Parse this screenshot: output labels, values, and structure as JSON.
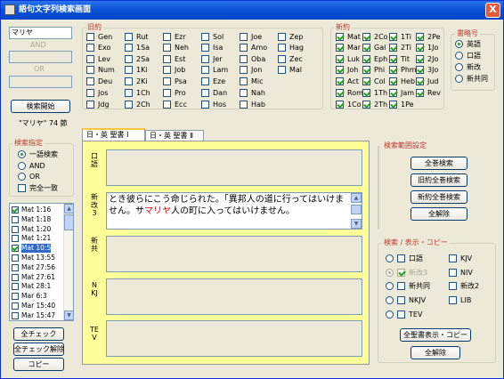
{
  "window": {
    "title": "語句文字列検索画面",
    "close_label": "X"
  },
  "search": {
    "term1": "マリヤ",
    "op_and": "AND",
    "op_or": "OR",
    "start_button": "検索開始",
    "result_text": "\"マリヤ\" 74 節"
  },
  "search_mode": {
    "title": "検索指定",
    "options": [
      {
        "label": "一語検索",
        "selected": true
      },
      {
        "label": "AND",
        "selected": false
      },
      {
        "label": "OR",
        "selected": false
      }
    ],
    "exact_match": {
      "label": "完全一致",
      "checked": false
    }
  },
  "old_testament": {
    "title": "旧約",
    "books": [
      [
        "Gen",
        "Rut",
        "Ezr",
        "Sol",
        "Joe",
        "Zep"
      ],
      [
        "Exo",
        "1Sa",
        "Neh",
        "Isa",
        "Amo",
        "Hag"
      ],
      [
        "Lev",
        "2Sa",
        "Est",
        "Jer",
        "Oba",
        "Zec"
      ],
      [
        "Num",
        "1Ki",
        "Job",
        "Lam",
        "Jon",
        "Mal"
      ],
      [
        "Deu",
        "2Ki",
        "Psa",
        "Eze",
        "Mic",
        ""
      ],
      [
        "Jos",
        "1Ch",
        "Pro",
        "Dan",
        "Nah",
        ""
      ],
      [
        "Jdg",
        "2Ch",
        "Ecc",
        "Hos",
        "Hab",
        ""
      ]
    ]
  },
  "new_testament": {
    "title": "新約",
    "books": [
      [
        "Mat",
        "2Co",
        "1Ti",
        "2Pe"
      ],
      [
        "Mar",
        "Gal",
        "2Ti",
        "1Jo"
      ],
      [
        "Luk",
        "Eph",
        "Tit",
        "2Jo"
      ],
      [
        "Joh",
        "Phi",
        "Phm",
        "3Jo"
      ],
      [
        "Act",
        "Col",
        "Heb",
        "Jud"
      ],
      [
        "Rom",
        "1Th",
        "Jam",
        "Rev"
      ],
      [
        "1Co",
        "2Th",
        "1Pe",
        ""
      ]
    ]
  },
  "book_names": {
    "title": "書略号",
    "options": [
      {
        "label": "英語",
        "selected": true
      },
      {
        "label": "口語",
        "selected": false
      },
      {
        "label": "新改",
        "selected": false
      },
      {
        "label": "新共同",
        "selected": false
      }
    ]
  },
  "results": {
    "items": [
      {
        "ref": "Mat 1:16",
        "checked": true,
        "selected": false
      },
      {
        "ref": "Mat 1:18",
        "checked": false,
        "selected": false
      },
      {
        "ref": "Mat 1:20",
        "checked": false,
        "selected": false
      },
      {
        "ref": "Mat 1:21",
        "checked": false,
        "selected": false
      },
      {
        "ref": "Mat 10:5",
        "checked": true,
        "selected": true
      },
      {
        "ref": "Mat 13:55",
        "checked": false,
        "selected": false
      },
      {
        "ref": "Mat 27:56",
        "checked": false,
        "selected": false
      },
      {
        "ref": "Mat 27:61",
        "checked": false,
        "selected": false
      },
      {
        "ref": "Mat 28:1",
        "checked": false,
        "selected": false
      },
      {
        "ref": "Mar 6:3",
        "checked": false,
        "selected": false
      },
      {
        "ref": "Mar 15:40",
        "checked": false,
        "selected": false
      },
      {
        "ref": "Mar 15:47",
        "checked": false,
        "selected": false
      }
    ],
    "check_all": "全チェック",
    "uncheck_all": "全チェック解除",
    "copy": "コピー"
  },
  "tabs": [
    {
      "label": "日・英 聖書 Ⅰ",
      "active": true
    },
    {
      "label": "日・英 聖書 Ⅱ",
      "active": false
    }
  ],
  "versions": [
    {
      "label": "口語",
      "text": ""
    },
    {
      "label": "新改3",
      "text_before": "とき彼らにこう命じられた。「異邦人の道に行ってはいけません。サ",
      "text_highlight": "マリヤ",
      "text_after": "人の町に入ってはいけません。"
    },
    {
      "label": "新共",
      "text": ""
    },
    {
      "label": "NKJ",
      "text": ""
    },
    {
      "label": "TEV",
      "text": ""
    }
  ],
  "range": {
    "title": "検索範囲設定",
    "all_books": "全巻検索",
    "old_all": "旧約全巻検索",
    "new_all": "新約全巻検索",
    "clear": "全解除"
  },
  "display": {
    "title": "検索 / 表示・コピー",
    "left": [
      {
        "label": "口語",
        "radio": false,
        "checked": false,
        "disabled": false
      },
      {
        "label": "新改3",
        "radio": true,
        "checked": true,
        "disabled": true
      },
      {
        "label": "新共同",
        "radio": false,
        "checked": false,
        "disabled": false
      },
      {
        "label": "NKJV",
        "radio": false,
        "checked": false,
        "disabled": false
      },
      {
        "label": "TEV",
        "radio": false,
        "checked": false,
        "disabled": false
      }
    ],
    "right": [
      {
        "label": "KJV",
        "checked": false
      },
      {
        "label": "NIV",
        "checked": false
      },
      {
        "label": "新改2",
        "checked": false
      },
      {
        "label": "LIB",
        "checked": false
      }
    ],
    "show_all": "全聖書表示・コピー",
    "clear": "全解除"
  }
}
